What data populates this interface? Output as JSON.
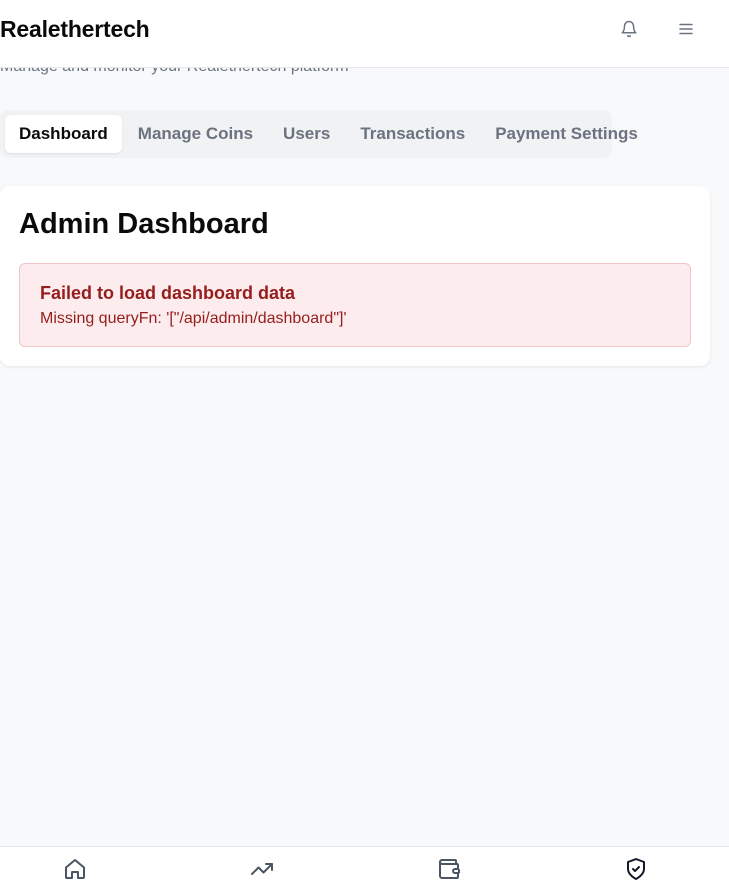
{
  "header": {
    "brand": "Realethertech",
    "subtitle": "Manage and monitor your Realethertech platform",
    "notifications_icon": "bell-icon",
    "menu_icon": "hamburger-menu-icon"
  },
  "tabs": [
    {
      "label": "Dashboard",
      "active": true
    },
    {
      "label": "Manage Coins",
      "active": false
    },
    {
      "label": "Users",
      "active": false
    },
    {
      "label": "Transactions",
      "active": false
    },
    {
      "label": "Payment Settings",
      "active": false
    }
  ],
  "main": {
    "title": "Admin Dashboard",
    "error": {
      "title": "Failed to load dashboard data",
      "message": "Missing queryFn: '[\"/api/admin/dashboard\"]'"
    }
  },
  "bottom_nav": [
    {
      "icon": "home-icon",
      "active": false
    },
    {
      "icon": "trending-up-icon",
      "active": false
    },
    {
      "icon": "wallet-icon",
      "active": false
    },
    {
      "icon": "shield-check-icon",
      "active": true
    }
  ],
  "colors": {
    "background": "#f8f9fb",
    "error_text": "#961d1d",
    "error_bg": "#fdeced",
    "error_border": "#f4c5c8",
    "muted_text": "#6b7280"
  }
}
